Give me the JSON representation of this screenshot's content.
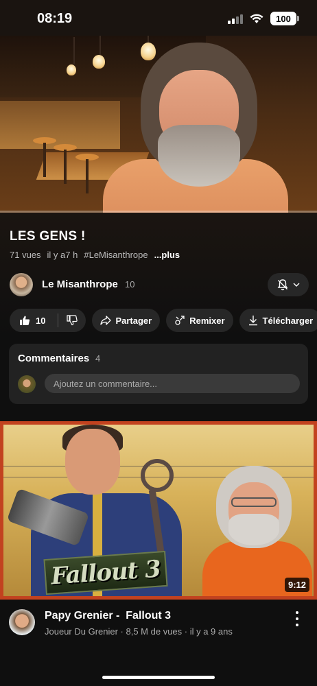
{
  "status_bar": {
    "time": "08:19",
    "battery": "100",
    "icons": [
      "signal-icon",
      "wifi-icon",
      "battery-icon"
    ]
  },
  "video": {
    "title": "LES GENS !",
    "views": "71 vues",
    "age": "il y a7 h",
    "hashtag": "#LeMisanthrope",
    "more": "...plus"
  },
  "channel": {
    "name": "Le Misanthrope",
    "subscribers": "10",
    "bell_icon": "bell-off-icon"
  },
  "actions": {
    "like_count": "10",
    "share": "Partager",
    "remix": "Remixer",
    "download": "Télécharger",
    "icons": [
      "thumbs-up-icon",
      "thumbs-down-icon",
      "share-icon",
      "remix-icon",
      "download-icon"
    ]
  },
  "comments": {
    "title": "Commentaires",
    "count": "4",
    "placeholder": "Ajoutez un commentaire..."
  },
  "recommended": {
    "title": "Papy Grenier -  Fallout 3",
    "meta": "Joueur Du Grenier · 8,5 M de vues · il y a 9 ans",
    "duration": "9:12",
    "logo_text": "Fallout 3",
    "border_color": "#c2421f"
  }
}
